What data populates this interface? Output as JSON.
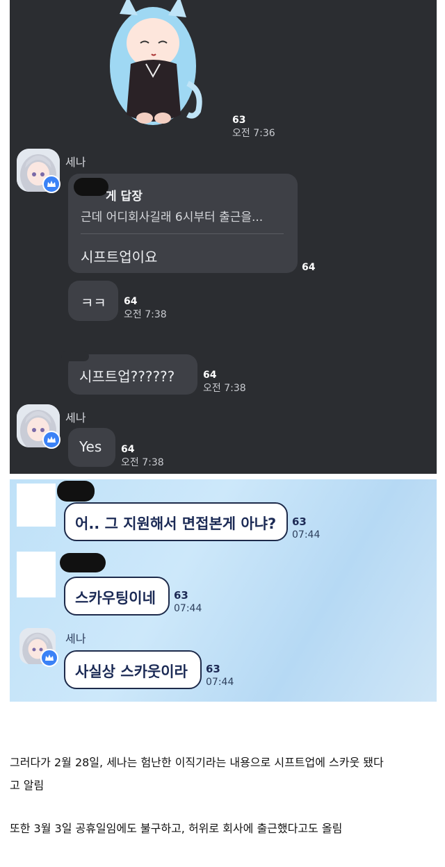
{
  "dark_chat": {
    "sticker_meta": {
      "count": "63",
      "time": "오전 7:36"
    },
    "sender_name": "세나",
    "reply_bubble": {
      "reply_header": "게 답장",
      "quoted_text": "근데 어디회사길래 6시부터 출근을...",
      "text": "시프트업이요",
      "count": "64"
    },
    "msg_kk": {
      "text": "ㅋㅋ",
      "count": "64",
      "time": "오전 7:38"
    },
    "msg_shiftup": {
      "text": "시프트업??????",
      "count": "64",
      "time": "오전 7:38"
    },
    "sender_name_2": "세나",
    "msg_yes": {
      "text": "Yes",
      "count": "64",
      "time": "오전 7:38"
    }
  },
  "light_chat": {
    "msg_1": {
      "text": "어.. 그 지원해서 면접본게 아냐?",
      "count": "63",
      "time": "07:44"
    },
    "msg_2": {
      "text": "스카우팅이네",
      "count": "63",
      "time": "07:44"
    },
    "sender_name": "세나",
    "msg_3": {
      "text": "사실상 스카웃이라",
      "count": "63",
      "time": "07:44"
    }
  },
  "article": {
    "para_1_line_1": "그러다가 2월 28일, 세나는 험난한 이직기라는 내용으로 시프트업에 스카웃 됐다",
    "para_1_line_2": "고 알림",
    "para_2": "또한 3월 3일 공휴일임에도 불구하고, 허위로 회사에 출근했다고도 올림"
  },
  "colors": {
    "dark_bg": "#2b2d31",
    "dark_bubble": "#3e4046",
    "light_bubble_border": "#1d2a4a",
    "badge_blue": "#3b82f6"
  }
}
